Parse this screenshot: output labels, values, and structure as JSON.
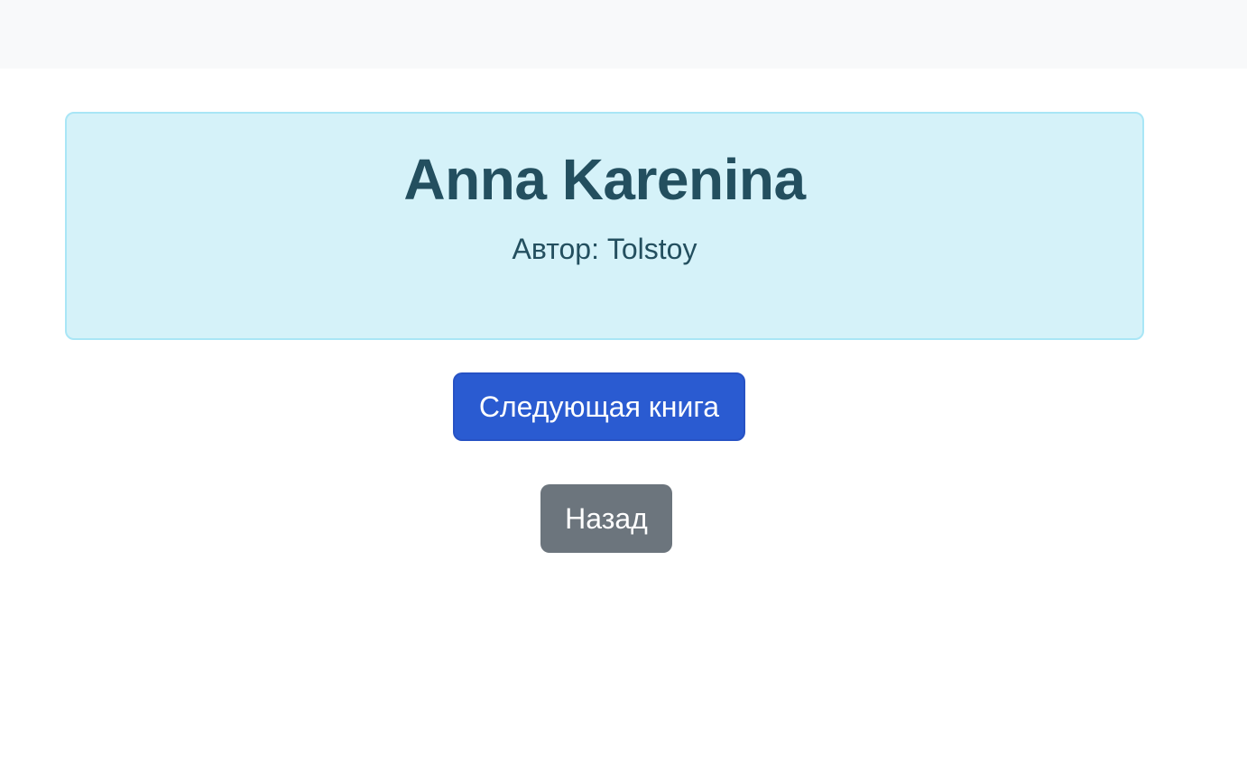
{
  "book": {
    "title": "Anna Karenina",
    "author_label": "Автор:",
    "author_name": "Tolstoy"
  },
  "actions": {
    "next_label": "Следующая книга",
    "back_label": "Назад"
  },
  "colors": {
    "topbar": "#f8f9fa",
    "card_background": "#d5f2f9",
    "card_border": "#a9e6f6",
    "card_text": "#234f5f",
    "primary": "#2a5bd1",
    "secondary": "#6c757d"
  }
}
